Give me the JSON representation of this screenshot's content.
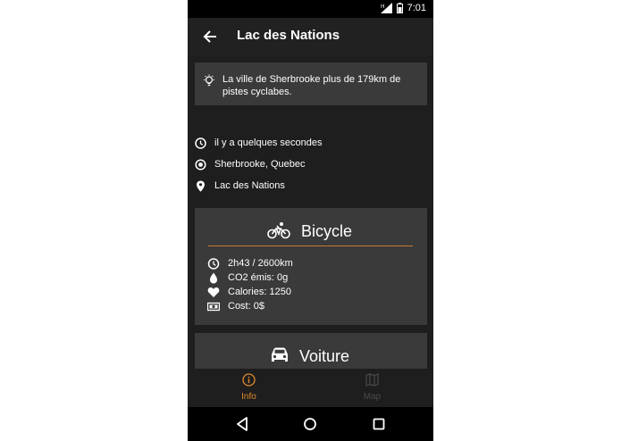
{
  "status_bar": {
    "time": "7:01",
    "network_icon": "signal-icon",
    "battery_icon": "battery-icon"
  },
  "toolbar": {
    "title": "Lac des Nations",
    "back_icon": "arrow-left-icon"
  },
  "tip": {
    "text": "La ville de Sherbrooke plus de 179km de pistes cyclabes.",
    "icon": "lightbulb-icon"
  },
  "info": {
    "time": "il y a quelques secondes",
    "location": "Sherbrooke, Quebec",
    "place": "Lac des Nations"
  },
  "modes": [
    {
      "label": "Bicycle",
      "icon": "bicycle-icon",
      "stats": {
        "duration_distance": "2h43 / 2600km",
        "co2": "CO2 émis: 0g",
        "calories": "Calories: 1250",
        "cost": "Cost: 0$"
      }
    },
    {
      "label": "Voiture",
      "icon": "car-icon"
    }
  ],
  "bottom_nav": {
    "tabs": [
      {
        "label": "Info",
        "active": true
      },
      {
        "label": "Map",
        "active": false
      }
    ]
  },
  "colors": {
    "accent": "#e08a2e",
    "card": "#3a3a3a",
    "background": "#1e1e1e"
  }
}
